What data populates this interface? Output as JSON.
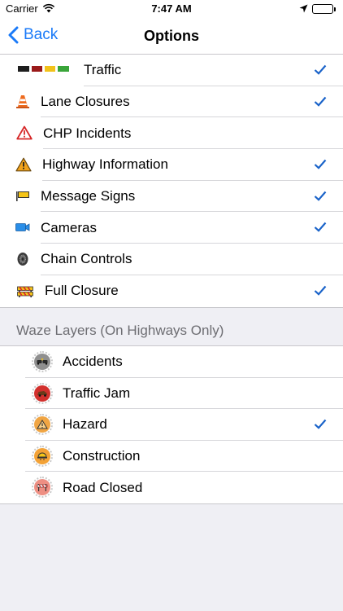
{
  "status_bar": {
    "carrier": "Carrier",
    "time": "7:47 AM"
  },
  "nav": {
    "back_label": "Back",
    "title": "Options"
  },
  "options": [
    {
      "label": "Traffic",
      "icon": "traffic-legend-icon",
      "checked": true
    },
    {
      "label": "Lane Closures",
      "icon": "traffic-cone-icon",
      "checked": true
    },
    {
      "label": "CHP Incidents",
      "icon": "warning-outline-icon",
      "checked": false
    },
    {
      "label": "Highway Information",
      "icon": "warning-filled-icon",
      "checked": true
    },
    {
      "label": "Message Signs",
      "icon": "message-sign-icon",
      "checked": true
    },
    {
      "label": "Cameras",
      "icon": "camera-icon",
      "checked": true
    },
    {
      "label": "Chain Controls",
      "icon": "tire-chain-icon",
      "checked": false
    },
    {
      "label": "Full Closure",
      "icon": "road-barrier-icon",
      "checked": true
    }
  ],
  "waze_section": {
    "header": "Waze Layers (On Highways Only)",
    "items": [
      {
        "label": "Accidents",
        "icon": "accident-icon",
        "color": "#8f8f8f",
        "checked": false
      },
      {
        "label": "Traffic Jam",
        "icon": "traffic-jam-icon",
        "color": "#d2302d",
        "checked": false
      },
      {
        "label": "Hazard",
        "icon": "hazard-icon",
        "color": "#f0a543",
        "checked": true
      },
      {
        "label": "Construction",
        "icon": "construction-icon",
        "color": "#f3a236",
        "checked": false
      },
      {
        "label": "Road Closed",
        "icon": "road-closed-icon",
        "color": "#ee8f83",
        "checked": false
      }
    ]
  },
  "colors": {
    "accent": "#1a7af8",
    "check": "#1a63c9"
  }
}
